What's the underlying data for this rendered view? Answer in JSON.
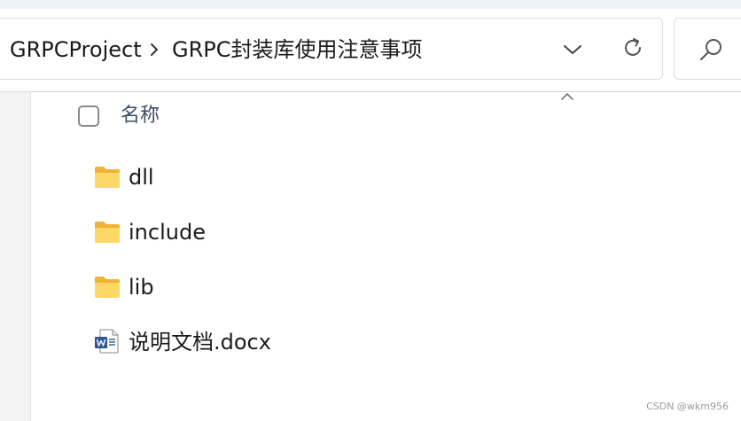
{
  "breadcrumb": {
    "parent": "GRPCProject",
    "current": "GRPC封装库使用注意事项"
  },
  "file_list": {
    "column_name": "名称",
    "items": [
      {
        "name": "dll",
        "type": "folder"
      },
      {
        "name": "include",
        "type": "folder"
      },
      {
        "name": "lib",
        "type": "folder"
      },
      {
        "name": "说明文档.docx",
        "type": "word-document"
      }
    ]
  },
  "icons": {
    "breadcrumb_separator": "chevron-right-icon",
    "address_dropdown": "chevron-down-icon",
    "refresh": "refresh-icon",
    "search": "search-icon",
    "sort_indicator": "chevron-up-icon",
    "folder": "folder-icon",
    "word": "word-document-icon"
  },
  "colors": {
    "folder_yellow": "#f8c94a",
    "word_blue": "#2b579a",
    "header_text": "#3b4a63"
  },
  "watermark": "CSDN @wkm956"
}
